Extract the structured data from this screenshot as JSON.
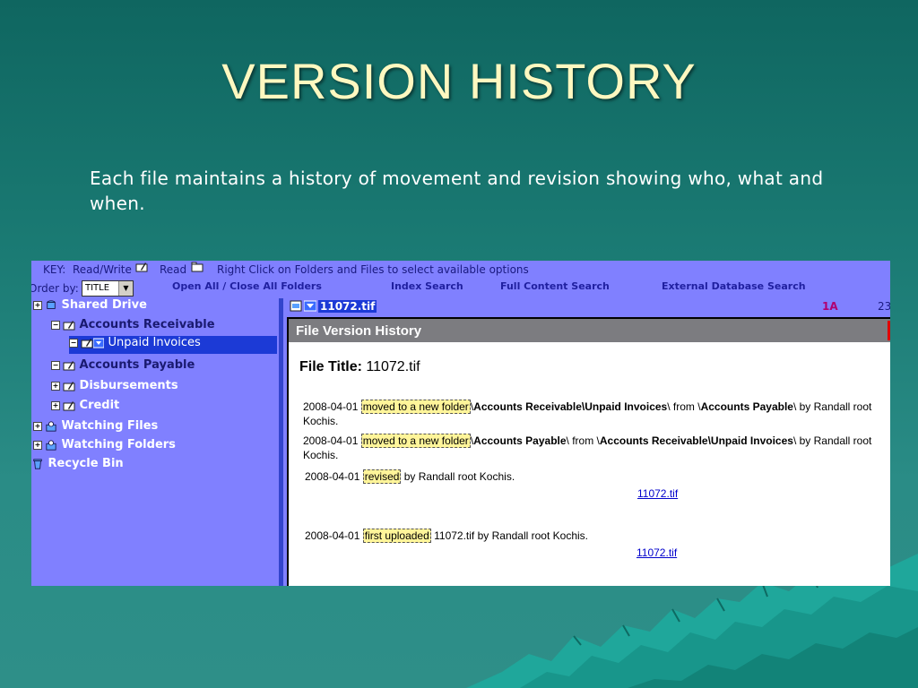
{
  "slide": {
    "title": "VERSION HISTORY",
    "body": "Each file maintains a history of movement and revision showing who, what and when."
  },
  "app": {
    "key_label": "KEY:",
    "key_readwrite": "Read/Write",
    "key_read": "Read",
    "key_hint": "Right Click on Folders and Files to select available options",
    "order_label": "Order by:",
    "order_value": "TITLE",
    "nav": {
      "open_close": "Open All / Close All Folders",
      "index_search": "Index Search",
      "full_content": "Full Content Search",
      "external_db": "External Database Search"
    },
    "tree": [
      {
        "label": "Shared Drive",
        "pm": "+"
      },
      {
        "label": "Accounts Receivable",
        "pm": "−"
      },
      {
        "label": "Unpaid Invoices",
        "pm": "−"
      },
      {
        "label": "Accounts Payable",
        "pm": "−"
      },
      {
        "label": "Disbursements",
        "pm": "+"
      },
      {
        "label": "Credit",
        "pm": "+"
      },
      {
        "label": "Watching Files",
        "pm": "+"
      },
      {
        "label": "Watching Folders",
        "pm": "+"
      },
      {
        "label": "Recycle Bin",
        "pm": ""
      }
    ],
    "file_bar": {
      "name": "11072.tif",
      "code": "1A",
      "num": "23"
    },
    "panel": {
      "header": "File Version History",
      "title_label": "File Title:",
      "title_value": "11072.tif",
      "entries": [
        {
          "date": "2008-04-01",
          "action": "moved to a new folder",
          "p1": "\\",
          "b1": "Accounts Receivable\\Unpaid Invoices",
          "p2": "\\ from \\",
          "b2": "Accounts Payable",
          "p3": "\\ by Randall root Kochis."
        },
        {
          "date": "2008-04-01",
          "action": "moved to a new folder",
          "p1": "\\",
          "b1": "Accounts Payable",
          "p2": "\\ from \\",
          "b2": "Accounts Receivable\\Unpaid Invoices",
          "p3": "\\ by Randall root Kochis."
        },
        {
          "date": "2008-04-01",
          "action": "revised",
          "tail": " by Randall root Kochis."
        },
        {
          "date": "2008-04-01",
          "action": "first uploaded",
          "tail": " 11072.tif by Randall root Kochis."
        }
      ],
      "link1": "11072.tif",
      "link2": "11072.tif"
    }
  },
  "colors": {
    "app_bg": "#8080ff",
    "selection": "#1c3ad6",
    "title_text": "#fff8c0",
    "highlight": "#fff59a"
  }
}
